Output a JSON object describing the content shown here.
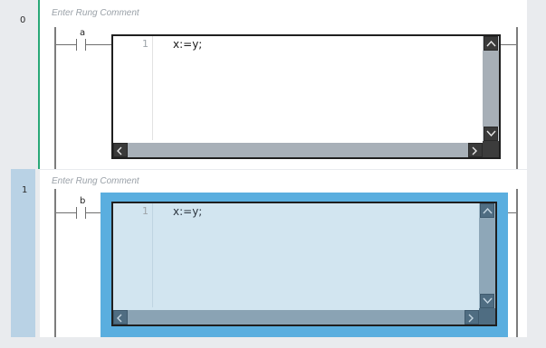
{
  "rungs": [
    {
      "number": "0",
      "comment_placeholder": "Enter Rung Comment",
      "contact": {
        "label": "a"
      },
      "st_editor": {
        "line_number": "1",
        "code": "x:=y;"
      },
      "selected": false
    },
    {
      "number": "1",
      "comment_placeholder": "Enter Rung Comment",
      "contact": {
        "label": "b"
      },
      "st_editor": {
        "line_number": "1",
        "code": "x:=y;"
      },
      "selected": true
    }
  ],
  "icons": {
    "scroll_up": "chevron-up-icon",
    "scroll_down": "chevron-down-icon",
    "scroll_left": "chevron-left-icon",
    "scroll_right": "chevron-right-icon"
  },
  "colors": {
    "rung_rail_active": "#2aa877",
    "selection_highlight": "#5aaedf",
    "selected_editor_bg": "#d2e5f0"
  }
}
